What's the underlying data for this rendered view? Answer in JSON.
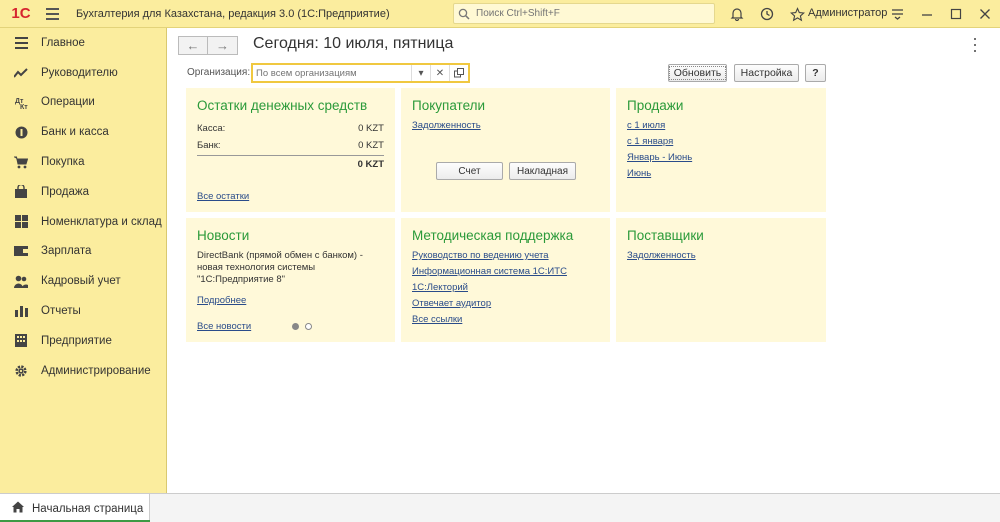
{
  "titlebar": {
    "logo": "1C",
    "app_title": "Бухгалтерия для Казахстана, редакция 3.0  (1С:Предприятие)",
    "search_placeholder": "Поиск Ctrl+Shift+F",
    "user": "Администратор"
  },
  "sidebar": {
    "items": [
      {
        "label": "Главное",
        "icon": "menu-lines-icon"
      },
      {
        "label": "Руководителю",
        "icon": "trend-chart-icon"
      },
      {
        "label": "Операции",
        "icon": "operations-icon"
      },
      {
        "label": "Банк и касса",
        "icon": "coin-icon"
      },
      {
        "label": "Покупка",
        "icon": "cart-icon"
      },
      {
        "label": "Продажа",
        "icon": "shopping-bag-icon"
      },
      {
        "label": "Номенклатура и склад",
        "icon": "grid-icon"
      },
      {
        "label": "Зарплата",
        "icon": "wallet-icon"
      },
      {
        "label": "Кадровый учет",
        "icon": "people-icon"
      },
      {
        "label": "Отчеты",
        "icon": "bar-chart-icon"
      },
      {
        "label": "Предприятие",
        "icon": "building-icon"
      },
      {
        "label": "Администрирование",
        "icon": "gear-icon"
      }
    ]
  },
  "main": {
    "title": "Сегодня: 10 июля, пятница",
    "org_label": "Организация:",
    "org_placeholder": "По всем организациям",
    "refresh_label": "Обновить",
    "settings_label": "Настройка",
    "help_label": "?"
  },
  "panels": {
    "cash": {
      "title": "Остатки денежных средств",
      "rows": [
        {
          "label": "Касса:",
          "value": "0 KZT"
        },
        {
          "label": "Банк:",
          "value": "0 KZT"
        }
      ],
      "total": "0 KZT",
      "link": "Все остатки"
    },
    "buyers": {
      "title": "Покупатели",
      "link": "Задолженность",
      "btn_invoice": "Счет",
      "btn_waybill": "Накладная"
    },
    "sales": {
      "title": "Продажи",
      "links": [
        "с 1 июля",
        "с 1 января",
        "Январь - Июнь",
        "Июнь"
      ]
    },
    "news": {
      "title": "Новости",
      "text": "DirectBank (прямой обмен с банком) - новая технология системы \"1С:Предприятие 8\"",
      "more": "Подробнее",
      "all": "Все новости"
    },
    "support": {
      "title": "Методическая поддержка",
      "links": [
        "Руководство по ведению учета",
        "Информационная система 1С:ИТС",
        "1С:Лекторий",
        "Отвечает аудитор",
        "Все ссылки"
      ]
    },
    "suppliers": {
      "title": "Поставщики",
      "link": "Задолженность"
    }
  },
  "bottombar": {
    "home_tab": "Начальная страница"
  },
  "colors": {
    "accent_yellow": "#fbed9e",
    "panel_bg": "#fff9d9",
    "panel_title_green": "#2b9a3a",
    "link_blue": "#2a4c8a",
    "logo_red": "#d6262f"
  }
}
